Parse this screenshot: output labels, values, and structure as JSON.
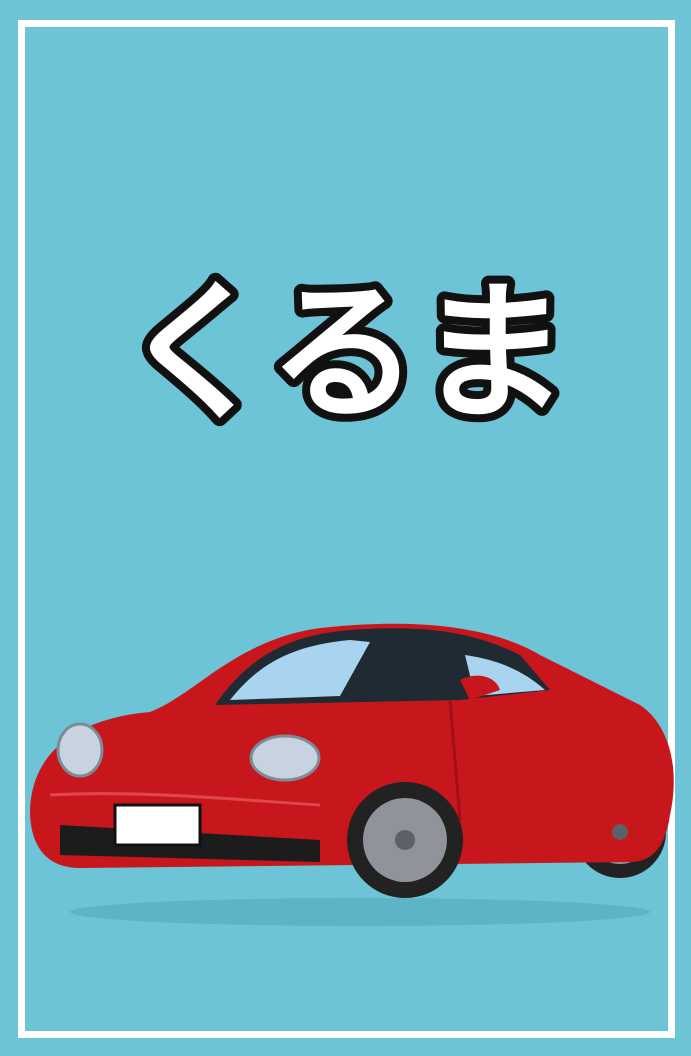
{
  "card": {
    "word": "くるま",
    "colors": {
      "background": "#6cc4d6",
      "frame": "#ffffff",
      "text_fill": "#ffffff",
      "text_outline": "#111111",
      "car_body": "#c8161d"
    },
    "picture": {
      "icon": "car-icon"
    }
  }
}
